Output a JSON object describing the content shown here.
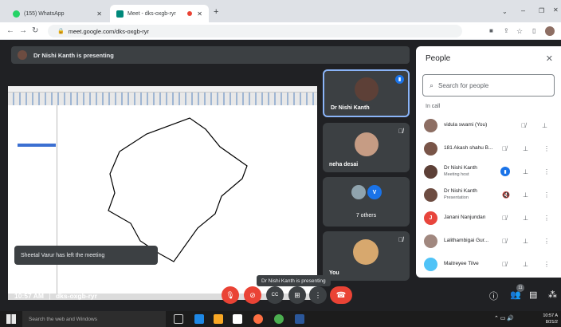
{
  "browser": {
    "tabs": [
      {
        "label": "(155) WhatsApp",
        "active": false
      },
      {
        "label": "Meet - dks-oxgb-ryr",
        "active": true
      }
    ],
    "url": "meet.google.com/dks-oxgb-ryr"
  },
  "meet": {
    "presenting_banner": "Dr Nishi Kanth is presenting",
    "tiles": [
      {
        "name": "Dr Nishi Kanth",
        "speaking": true
      },
      {
        "name": "neha desai",
        "muted": true
      },
      {
        "name": "7 others"
      },
      {
        "name": "You",
        "muted": true
      }
    ],
    "others_avatar_letter": "V",
    "toast": "Sheetal Varur has left the meeting",
    "tooltip": "Dr Nishi Kanth is presenting",
    "time": "10:57 AM",
    "meeting_code": "dks-oxgb-ryr",
    "participant_badge": "11"
  },
  "people": {
    "title": "People",
    "search_placeholder": "Search for people",
    "section": "In call",
    "participants": [
      {
        "name": "vidula swami (You)",
        "sub": "",
        "color": "#8d6e63"
      },
      {
        "name": "181 Akash shahu B...",
        "sub": "",
        "color": "#795548"
      },
      {
        "name": "Dr Nishi Kanth",
        "sub": "Meeting host",
        "color": "#5d4037"
      },
      {
        "name": "Dr Nishi Kanth",
        "sub": "Presentation",
        "color": "#6d4c41"
      },
      {
        "name": "Janani Nanjundan",
        "sub": "",
        "color": "#e8453c",
        "letter": "J"
      },
      {
        "name": "Lalithambigai Gur...",
        "sub": "",
        "color": "#a1887f"
      },
      {
        "name": "Maitreyee Tilve",
        "sub": "",
        "color": "#4fc3f7"
      }
    ]
  },
  "taskbar": {
    "search_placeholder": "Search the web and Windows",
    "clock_time": "10:57 A",
    "clock_date": "8/21/2"
  }
}
